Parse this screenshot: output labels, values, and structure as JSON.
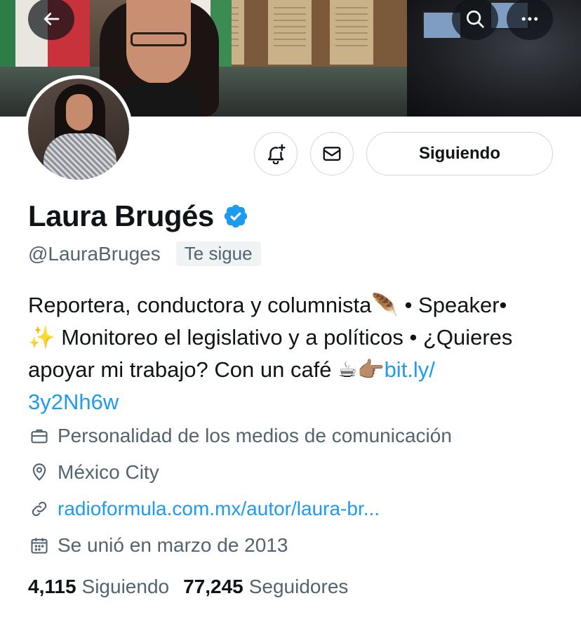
{
  "header": {
    "back_icon": "arrow-left-icon",
    "search_icon": "search-icon",
    "more_icon": "more-horizontal-icon"
  },
  "actions": {
    "notify_icon": "bell-plus-icon",
    "message_icon": "mail-icon",
    "follow_label": "Siguiendo"
  },
  "profile": {
    "name": "Laura Brugés",
    "verified_icon": "verified-badge-icon",
    "handle": "@LauraBruges",
    "follows_you": "Te sigue",
    "bio": {
      "line1": "Reportera, conductora y columnista",
      "line1_emoji": "🪶",
      "line1_tail": "• Speaker•",
      "line2_emoji": "✨",
      "line2": "Monitoreo el legislativo y a políticos • ¿Quieres",
      "line3": "apoyar mi trabajo? Con un café",
      "line3_emoji": "☕👉🏽",
      "link_part1": "bit.ly/",
      "link_part2": "3y2Nh6w"
    },
    "category": "Personalidad de los medios de comunicación",
    "location": "México City",
    "website": "radioformula.com.mx/autor/laura-br...",
    "joined": "Se unió en marzo de 2013"
  },
  "stats": {
    "following_count": "4,115",
    "following_label": "Siguiendo",
    "followers_count": "77,245",
    "followers_label": "Seguidores"
  },
  "colors": {
    "accent": "#1d9bf0",
    "secondary_text": "#536471",
    "primary_text": "#0f1419",
    "border": "#cfd9de"
  }
}
